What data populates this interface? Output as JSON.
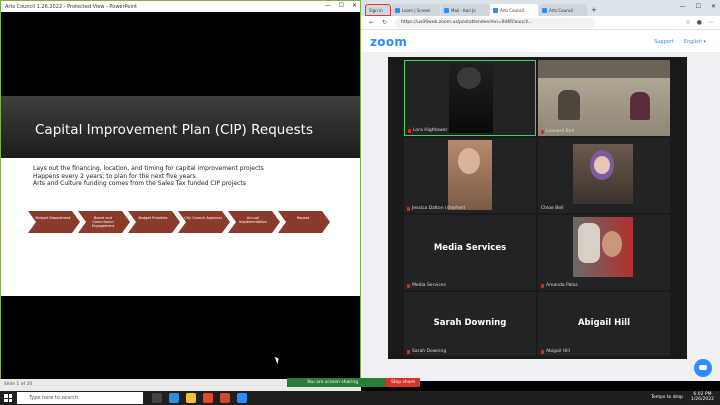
{
  "ppt": {
    "window_title": "Arts Council 1.26.2022 - Protected View - PowerPoint",
    "slide_title": "Capital Improvement Plan (CIP) Requests",
    "bullets": [
      "Lays out the financing, location, and timing for capital improvement projects",
      "Happens every 2 years, to plan for the next five years.",
      "Arts and Culture funding comes from the Sales Tax funded CIP projects"
    ],
    "process_steps": [
      "Budget Department",
      "Board and Commission Engagement",
      "Budget Priorities",
      "City Council Approval",
      "Annual Implementation",
      "Repeat"
    ],
    "status_left": "Slide 1 of 20"
  },
  "browser": {
    "tabs": [
      {
        "label": "Sign in",
        "active": false
      },
      {
        "label": "Loom | Screen",
        "active": false
      },
      {
        "label": "Mail - Kari Jo",
        "active": false
      },
      {
        "label": "Arts Council",
        "active": true
      },
      {
        "label": "Arts Council",
        "active": false
      }
    ],
    "url": "https://us06web.zoom.us/postattendee/mn=9d6f/launch..."
  },
  "zoom": {
    "logo": "zoom",
    "support_link": "Support",
    "language_link": "English ▾",
    "participants": [
      {
        "name": "Lora Hightower",
        "speaking": true,
        "type": "video"
      },
      {
        "name": "Leonard Bell",
        "speaking": false,
        "type": "video"
      },
      {
        "name": "Jessica Dalton (she/her)",
        "speaking": false,
        "type": "video"
      },
      {
        "name": "Chloe Bell",
        "speaking": false,
        "type": "video"
      },
      {
        "name": "Media Services",
        "speaking": false,
        "type": "name"
      },
      {
        "name": "Amanda Palos",
        "speaking": false,
        "type": "video"
      },
      {
        "name": "Sarah Downing",
        "speaking": false,
        "type": "name"
      },
      {
        "name": "Abigail Hill",
        "speaking": false,
        "type": "name"
      }
    ]
  },
  "sharebar": {
    "status": "You are screen sharing",
    "stop": "Stop share"
  },
  "taskbar": {
    "search_placeholder": "Type here to search",
    "tray_text": "Temps to drop",
    "time": "6:02 PM",
    "date": "1/26/2022"
  },
  "colors": {
    "zoom_blue": "#2d8cff",
    "speaking_green": "#3fd16b",
    "share_green": "#2b7d3a",
    "stop_red": "#d8342c",
    "arrow_fill": "#8a3b2c"
  }
}
